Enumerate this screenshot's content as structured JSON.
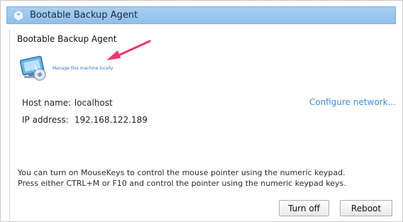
{
  "window": {
    "title": "Bootable Backup Agent"
  },
  "content": {
    "heading": "Bootable Backup Agent",
    "manage_link": "Manage this machine locally",
    "host_label": "Host name:",
    "host_value": "localhost",
    "ip_label": "IP address:",
    "ip_value": "192.168.122.189",
    "configure_link": "Configure network...",
    "info_line1": "You can turn on MouseKeys to control the mouse pointer using the numeric keypad.",
    "info_line2": "Press either CTRL+M or F10 and control the pointer using the numeric keypad keys."
  },
  "buttons": {
    "turn_off": "Turn off",
    "reboot": "Reboot"
  },
  "icons": {
    "title": "app-logo-icon",
    "manage": "computer-monitor-icon",
    "annotation": "arrow-annotation"
  },
  "colors": {
    "titlebar": "#9ec8f0",
    "link": "#3f8fd8",
    "arrow": "#f0356e"
  }
}
